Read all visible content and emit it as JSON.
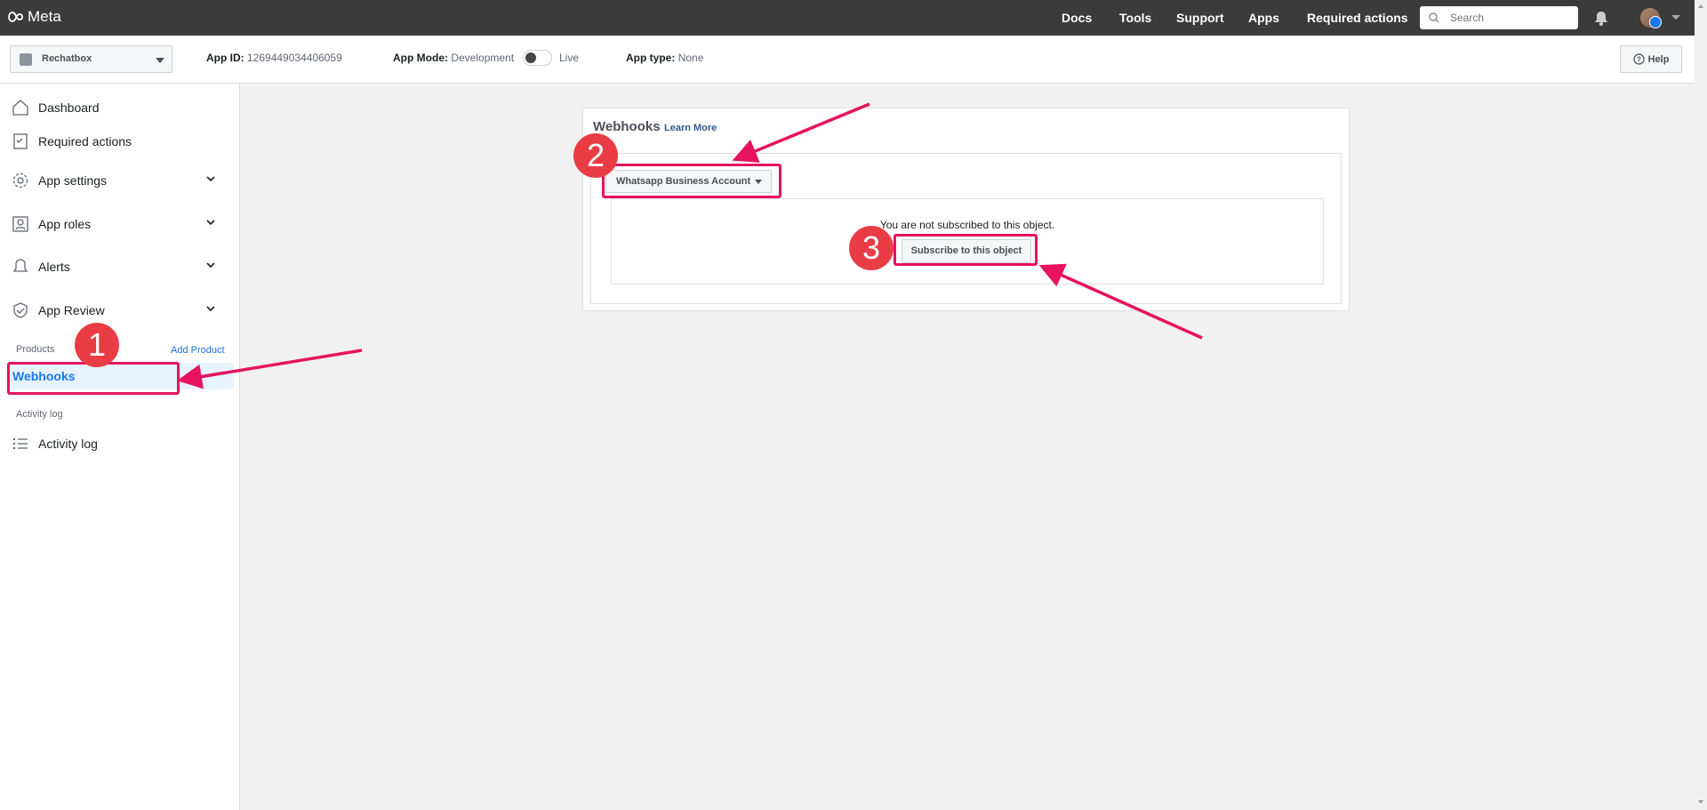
{
  "topbar": {
    "logo_text": "Meta",
    "nav": [
      "Docs",
      "Tools",
      "Support",
      "Apps",
      "Required actions"
    ],
    "search_placeholder": "Search"
  },
  "subbar": {
    "app_name": "Rechatbox",
    "app_id_label": "App ID:",
    "app_id_value": "1269449034406059",
    "app_mode_label": "App Mode:",
    "app_mode_value": "Development",
    "live_label": "Live",
    "app_type_label": "App type:",
    "app_type_value": "None",
    "help_label": "Help"
  },
  "sidebar": {
    "items": [
      {
        "label": "Dashboard"
      },
      {
        "label": "Required actions"
      },
      {
        "label": "App settings"
      },
      {
        "label": "App roles"
      },
      {
        "label": "Alerts"
      },
      {
        "label": "App Review"
      }
    ],
    "products_label": "Products",
    "add_product_label": "Add Product",
    "webhooks_label": "Webhooks",
    "activity_section_label": "Activity log",
    "activity_item_label": "Activity log"
  },
  "webhooks": {
    "title": "Webhooks",
    "learn_more": "Learn More",
    "object_selected": "Whatsapp Business Account",
    "not_subscribed_text": "You are not subscribed to this object.",
    "subscribe_button": "Subscribe to this object"
  },
  "annotations": {
    "step1": "1",
    "step2": "2",
    "step3": "3",
    "color": "#e6135e",
    "badge_color": "#ea3c44"
  }
}
